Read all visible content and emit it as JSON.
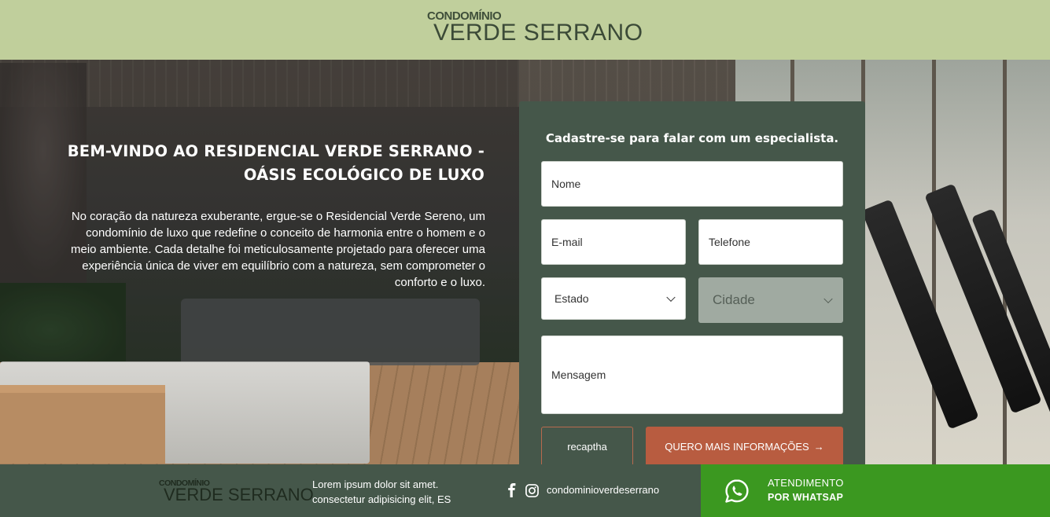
{
  "brand": {
    "logo_small": "CONDOMÍNIO",
    "logo_big": "VERDE SERRANO"
  },
  "hero": {
    "title_line1": "BEM-VINDO AO RESIDENCIAL VERDE SERRANO -",
    "title_line2": "OÁSIS ECOLÓGICO DE LUXO",
    "text": "No coração da natureza exuberante, ergue-se o Residencial Verde Sereno, um condomínio de luxo que redefine o conceito de harmonia entre o homem e o meio ambiente. Cada detalhe foi meticulosamente projetado para oferecer uma experiência única de viver em equilíbrio com a natureza, sem comprometer o conforto e o luxo."
  },
  "form": {
    "title": "Cadastre-se para falar com um especialista.",
    "nome_placeholder": "Nome",
    "email_placeholder": "E-mail",
    "telefone_placeholder": "Telefone",
    "estado_label": "Estado",
    "cidade_label": "Cidade",
    "mensagem_placeholder": "Mensagem",
    "recaptcha_label": "recaptha",
    "submit_label": "QUERO MAIS INFORMAÇÕES",
    "submit_arrow": "→"
  },
  "footer": {
    "logo_small": "CONDOMÍNIO",
    "logo_big": "VERDE SERRANO",
    "desc_line1": "Lorem ipsum dolor sit amet.",
    "desc_line2": "consectetur adipisicing elit, ES",
    "social_handle": "condominioverdeserrano",
    "icons": [
      "facebook-icon",
      "instagram-icon",
      "whatsapp-icon"
    ]
  },
  "whatsapp": {
    "line1": "ATENDIMENTO",
    "line2": "POR WHATSAP"
  },
  "colors": {
    "header_bg": "#c6d6a0",
    "card_bg": "#45574a",
    "submit_bg": "#b85c40",
    "whatsapp_bg": "#3b9820",
    "disabled_field": "#a0aaa1"
  }
}
